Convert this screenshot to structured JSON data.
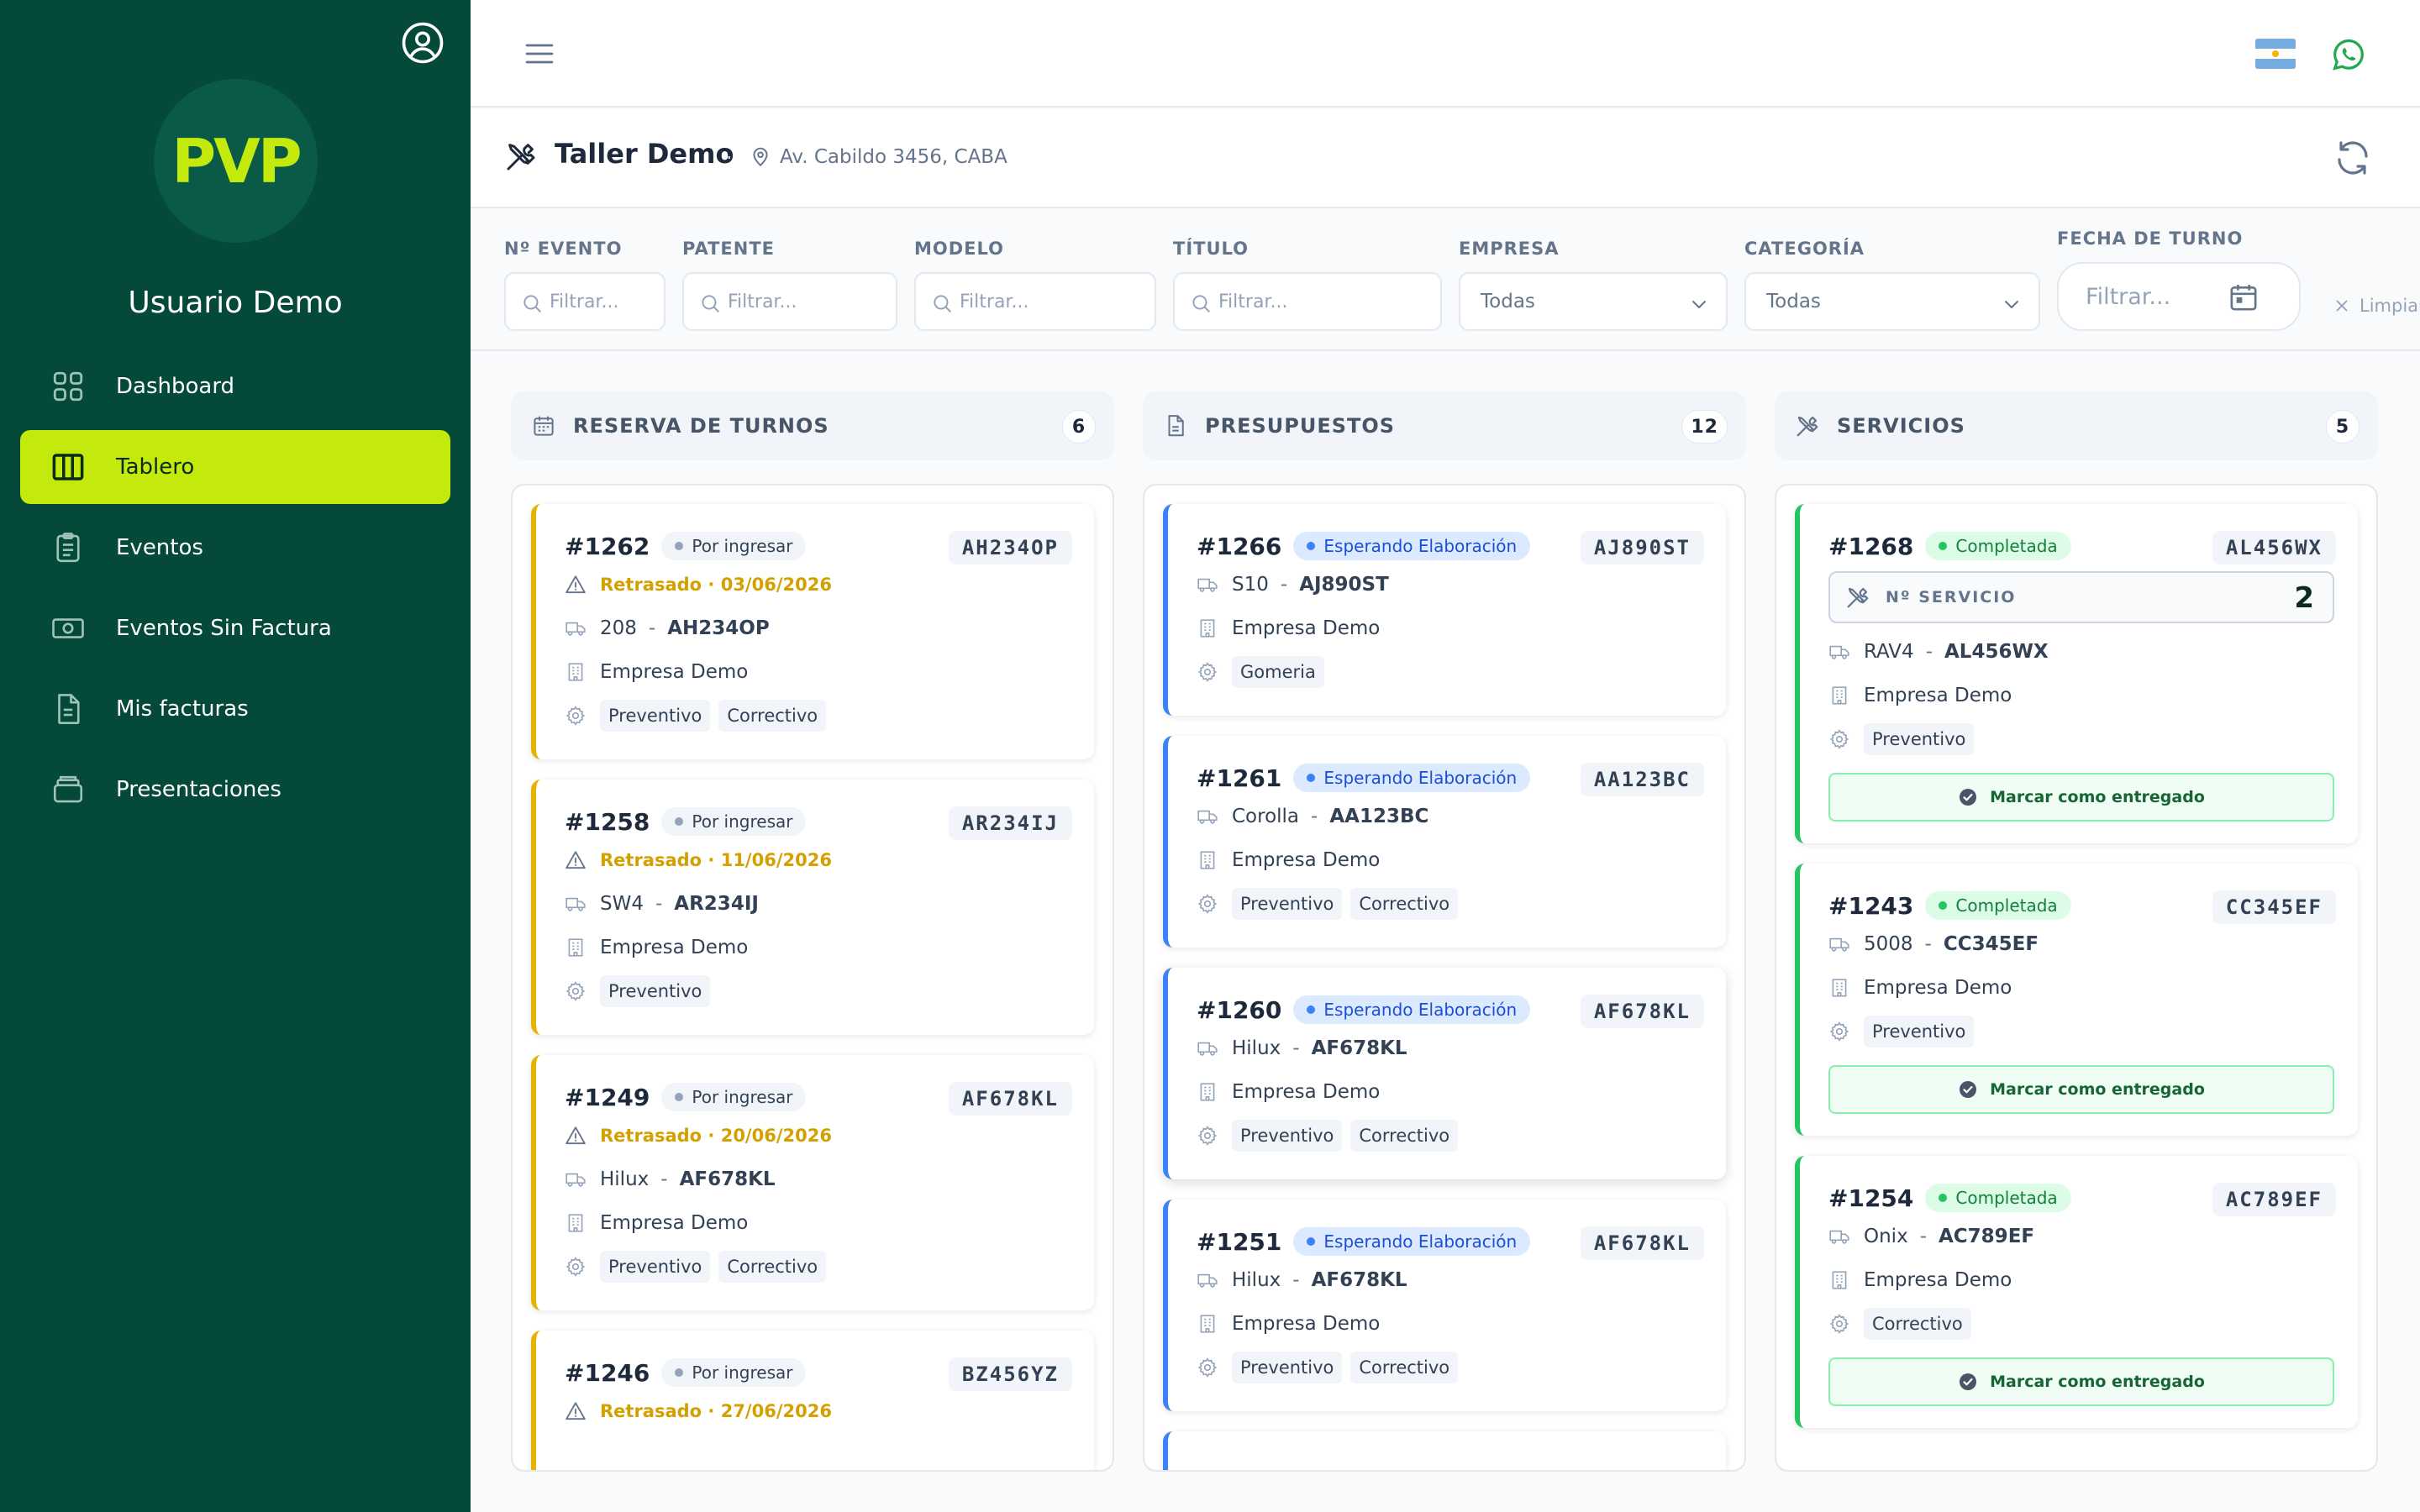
{
  "sidebar": {
    "logo_text": "PVP",
    "username": "Usuario Demo",
    "items": [
      {
        "label": "Dashboard",
        "icon": "grid-icon",
        "active": false
      },
      {
        "label": "Tablero",
        "icon": "columns-icon",
        "active": true
      },
      {
        "label": "Eventos",
        "icon": "clipboard-icon",
        "active": false
      },
      {
        "label": "Eventos Sin Factura",
        "icon": "banknote-icon",
        "active": false
      },
      {
        "label": "Mis facturas",
        "icon": "file-icon",
        "active": false
      },
      {
        "label": "Presentaciones",
        "icon": "layers-icon",
        "active": false
      }
    ],
    "accent": "#c3ea0c",
    "background": "#05493a"
  },
  "header": {
    "title": "Taller Demo",
    "separator": "·",
    "address": "Av. Cabildo 3456, CABA"
  },
  "filters": {
    "evento": {
      "label": "Nº EVENTO",
      "placeholder": "Filtrar..."
    },
    "patente": {
      "label": "PATENTE",
      "placeholder": "Filtrar..."
    },
    "modelo": {
      "label": "MODELO",
      "placeholder": "Filtrar..."
    },
    "titulo": {
      "label": "TÍTULO",
      "placeholder": "Filtrar..."
    },
    "empresa": {
      "label": "EMPRESA",
      "value": "Todas"
    },
    "categoria": {
      "label": "CATEGORÍA",
      "value": "Todas"
    },
    "fecha": {
      "label": "FECHA DE TURNO",
      "placeholder": "Filtrar..."
    },
    "clear_label": "Limpiar"
  },
  "columns": {
    "reservas": {
      "title": "RESERVA DE TURNOS",
      "count": "6",
      "cards": [
        {
          "id": "#1262",
          "status": "Por ingresar",
          "plate": "AH234OP",
          "warning": "Retrasado · 03/06/2026",
          "model": "208",
          "dash": "-",
          "patente": "AH234OP",
          "company": "Empresa Demo",
          "tags": [
            "Preventivo",
            "Correctivo"
          ]
        },
        {
          "id": "#1258",
          "status": "Por ingresar",
          "plate": "AR234IJ",
          "warning": "Retrasado · 11/06/2026",
          "model": "SW4",
          "dash": "-",
          "patente": "AR234IJ",
          "company": "Empresa Demo",
          "tags": [
            "Preventivo"
          ]
        },
        {
          "id": "#1249",
          "status": "Por ingresar",
          "plate": "AF678KL",
          "warning": "Retrasado · 20/06/2026",
          "model": "Hilux",
          "dash": "-",
          "patente": "AF678KL",
          "company": "Empresa Demo",
          "tags": [
            "Preventivo",
            "Correctivo"
          ]
        },
        {
          "id": "#1246",
          "status": "Por ingresar",
          "plate": "BZ456YZ",
          "warning": "Retrasado · 27/06/2026"
        }
      ]
    },
    "presupuestos": {
      "title": "PRESUPUESTOS",
      "count": "12",
      "cards": [
        {
          "id": "#1266",
          "status": "Esperando Elaboración",
          "plate": "AJ890ST",
          "model": "S10",
          "dash": "-",
          "patente": "AJ890ST",
          "company": "Empresa Demo",
          "tags": [
            "Gomeria"
          ]
        },
        {
          "id": "#1261",
          "status": "Esperando Elaboración",
          "plate": "AA123BC",
          "model": "Corolla",
          "dash": "-",
          "patente": "AA123BC",
          "company": "Empresa Demo",
          "tags": [
            "Preventivo",
            "Correctivo"
          ]
        },
        {
          "id": "#1260",
          "status": "Esperando Elaboración",
          "plate": "AF678KL",
          "model": "Hilux",
          "dash": "-",
          "patente": "AF678KL",
          "company": "Empresa Demo",
          "tags": [
            "Preventivo",
            "Correctivo"
          ]
        },
        {
          "id": "#1251",
          "status": "Esperando Elaboración",
          "plate": "AF678KL",
          "model": "Hilux",
          "dash": "-",
          "patente": "AF678KL",
          "company": "Empresa Demo",
          "tags": [
            "Preventivo",
            "Correctivo"
          ]
        }
      ]
    },
    "servicios": {
      "title": "SERVICIOS",
      "count": "5",
      "nserv_label": "Nº SERVICIO",
      "deliver_label": "Marcar como entregado",
      "cards": [
        {
          "id": "#1268",
          "status": "Completada",
          "plate": "AL456WX",
          "nserv": "2",
          "model": "RAV4",
          "dash": "-",
          "patente": "AL456WX",
          "company": "Empresa Demo",
          "tags": [
            "Preventivo"
          ]
        },
        {
          "id": "#1243",
          "status": "Completada",
          "plate": "CC345EF",
          "model": "5008",
          "dash": "-",
          "patente": "CC345EF",
          "company": "Empresa Demo",
          "tags": [
            "Preventivo"
          ]
        },
        {
          "id": "#1254",
          "status": "Completada",
          "plate": "AC789EF",
          "model": "Onix",
          "dash": "-",
          "patente": "AC789EF",
          "company": "Empresa Demo",
          "tags": [
            "Correctivo"
          ]
        }
      ]
    }
  },
  "colors": {
    "warning": "#d4a000",
    "blue_status": "#3b82f6",
    "green_status": "#22c55e"
  }
}
